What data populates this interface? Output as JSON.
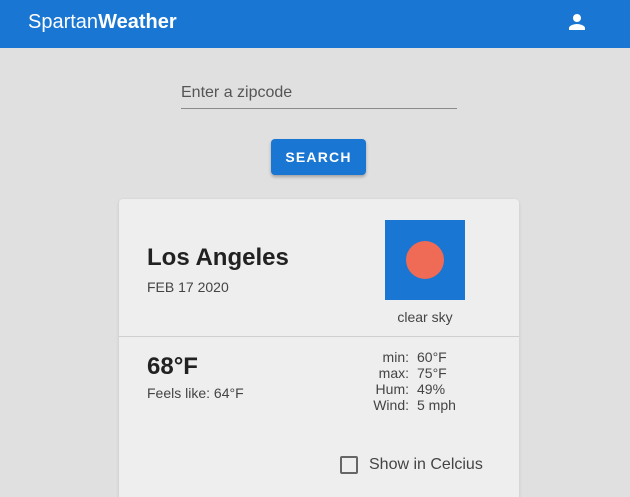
{
  "app": {
    "brand_prefix": "Spartan",
    "brand_suffix": "Weather",
    "header_color": "#1976d2",
    "user_icon": "account-icon"
  },
  "search": {
    "placeholder": "Enter a zipcode",
    "value": "",
    "button_label": "SEARCH"
  },
  "weather": {
    "city": "Los Angeles",
    "date": "FEB 17 2020",
    "condition_icon": "clear-sky-sun-icon",
    "condition": "clear sky",
    "temperature": "68°F",
    "feels_like": "Feels like: 64°F",
    "stats": [
      {
        "label": "min:",
        "value": "60°F"
      },
      {
        "label": "max:",
        "value": "75°F"
      },
      {
        "label": "Hum:",
        "value": "49%"
      },
      {
        "label": "Wind:",
        "value": "5 mph"
      }
    ],
    "celsius_label": "Show in Celcius",
    "celsius_checked": false
  }
}
